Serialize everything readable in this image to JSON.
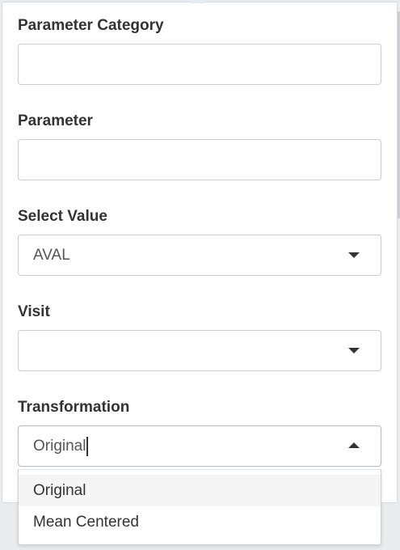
{
  "form": {
    "fields": [
      {
        "label": "Parameter Category",
        "value": ""
      },
      {
        "label": "Parameter",
        "value": ""
      },
      {
        "label": "Select Value",
        "value": "AVAL"
      },
      {
        "label": "Visit",
        "value": ""
      },
      {
        "label": "Transformation",
        "value": "Original"
      }
    ],
    "transformation_options": [
      "Original",
      "Mean Centered"
    ],
    "transformation_highlighted": "Original"
  },
  "colors": {
    "label_text": "#333333",
    "value_text": "#555555",
    "border": "#cccccc",
    "highlight_bg": "#f5f5f5",
    "page_bg": "#e9ecef"
  },
  "icons": {
    "closed_select": "triangle-down-icon",
    "open_select": "triangle-up-icon"
  }
}
